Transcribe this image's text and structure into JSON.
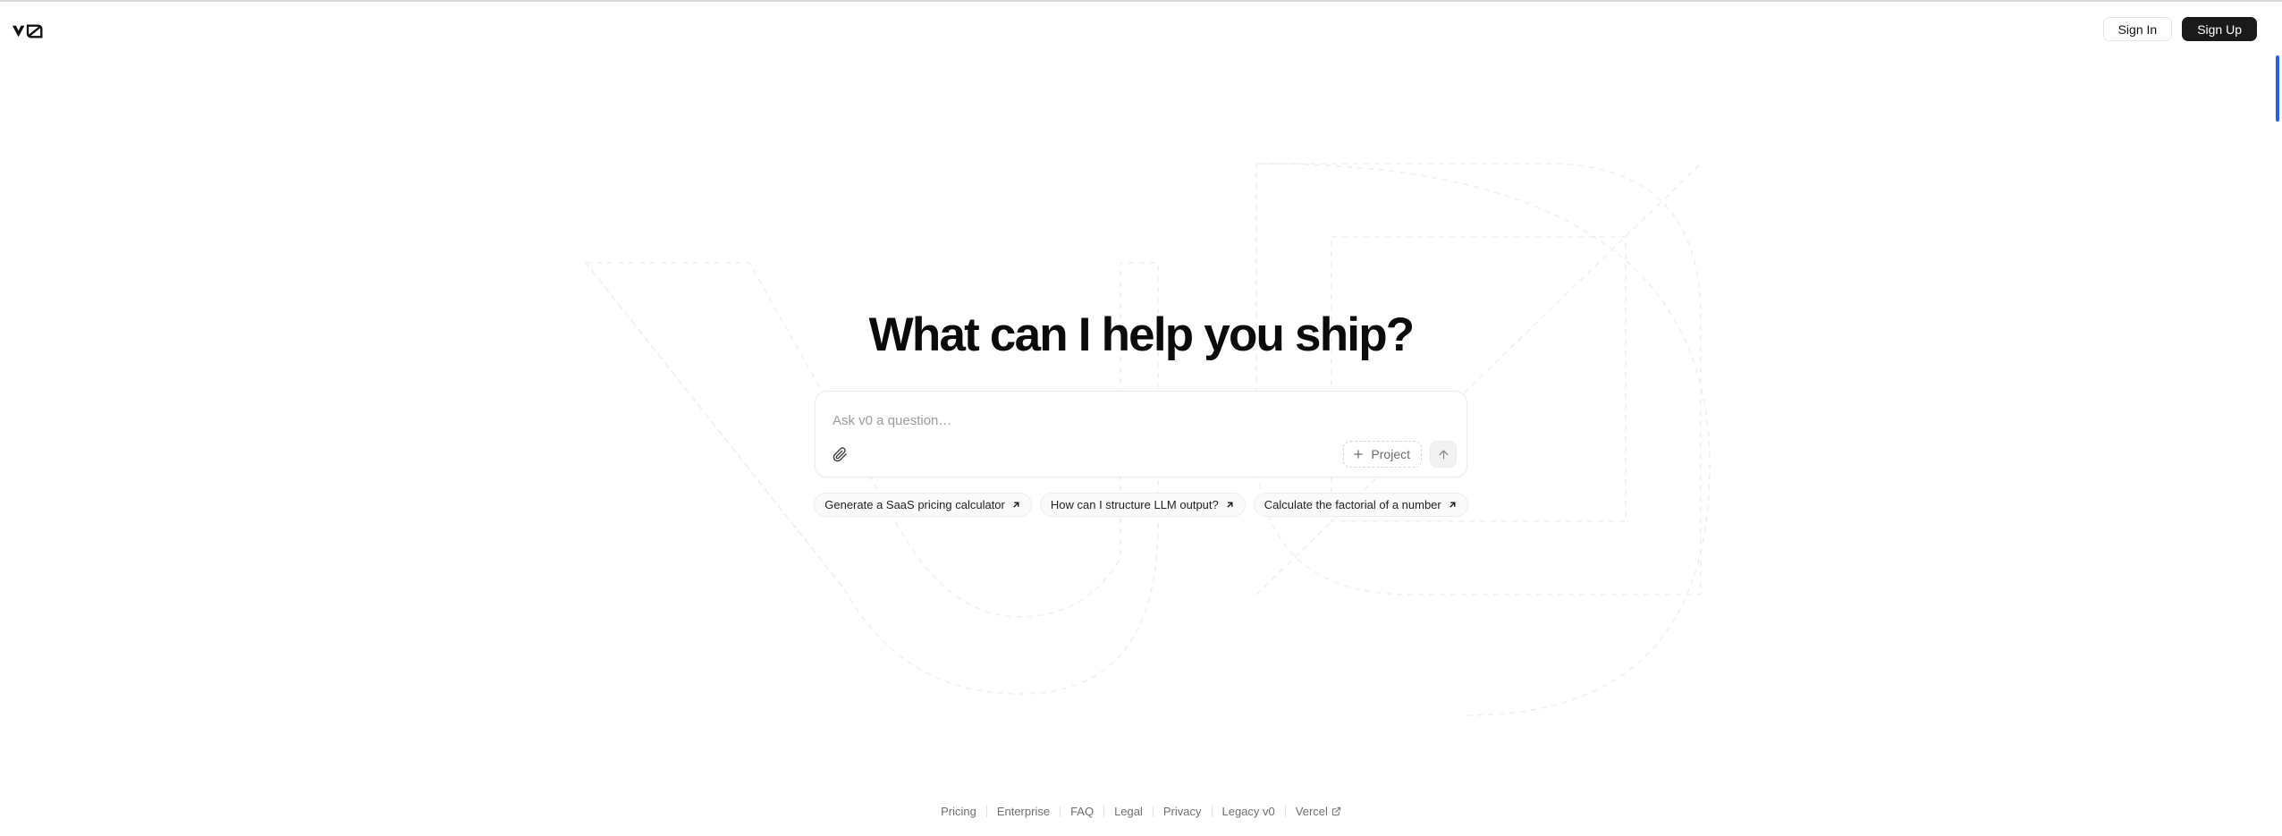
{
  "brand": {
    "logo_alt": "v0",
    "accent": "#1a1a1a",
    "scrollbar_color": "#2563eb"
  },
  "header": {
    "sign_in_label": "Sign In",
    "sign_up_label": "Sign Up"
  },
  "main": {
    "headline": "What can I help you ship?",
    "composer": {
      "placeholder": "Ask v0 a question…",
      "value": "",
      "attach_icon": "paperclip-icon",
      "project_label": "Project",
      "project_icon": "plus-icon",
      "submit_icon": "arrow-up-icon"
    },
    "suggestions": [
      {
        "label": "Generate a SaaS pricing calculator",
        "icon": "arrow-up-right-icon"
      },
      {
        "label": "How can I structure LLM output?",
        "icon": "arrow-up-right-icon"
      },
      {
        "label": "Calculate the factorial of a number",
        "icon": "arrow-up-right-icon"
      }
    ]
  },
  "footer": {
    "links": [
      {
        "label": "Pricing",
        "external": false
      },
      {
        "label": "Enterprise",
        "external": false
      },
      {
        "label": "FAQ",
        "external": false
      },
      {
        "label": "Legal",
        "external": false
      },
      {
        "label": "Privacy",
        "external": false
      },
      {
        "label": "Legacy v0",
        "external": false
      },
      {
        "label": "Vercel",
        "external": true
      }
    ]
  },
  "background": {
    "watermark": "v0-logo-outline",
    "stroke": "#f0f0f0"
  }
}
